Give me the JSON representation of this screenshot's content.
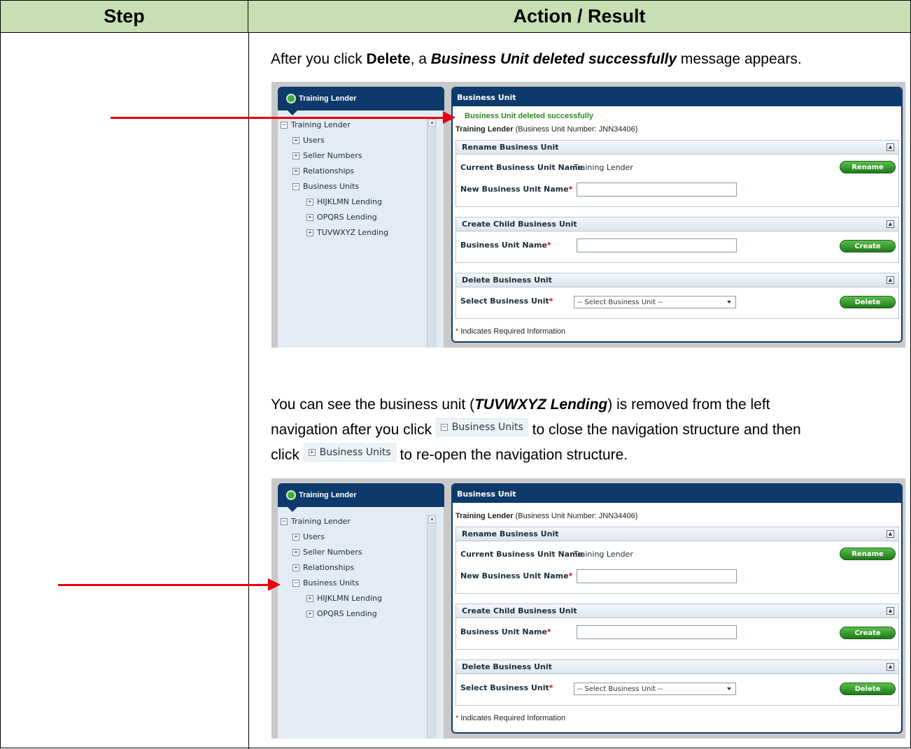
{
  "table": {
    "header_step": "Step",
    "header_action": "Action / Result"
  },
  "intro": {
    "before": "After you click ",
    "delete_word": "Delete",
    "mid": ", a ",
    "message_name": "Business Unit deleted successfully",
    "after": " message appears."
  },
  "explain": {
    "p1": "You can see the business unit (",
    "unit_name": "TUVWXYZ Lending",
    "p2": ") is removed from the left",
    "p3": "navigation after you click ",
    "p4": " to close the navigation structure and then",
    "p5": "click ",
    "p6": " to re-open the navigation structure.",
    "inline_label": "Business Units",
    "collapse_glyph": "−",
    "expand_glyph": "+"
  },
  "shot1": {
    "nav_tab": "Training Lender",
    "tree": [
      {
        "toggle": "−",
        "label": "Training Lender"
      },
      {
        "toggle": "+",
        "label": "Users"
      },
      {
        "toggle": "+",
        "label": "Seller Numbers"
      },
      {
        "toggle": "+",
        "label": "Relationships"
      },
      {
        "toggle": "−",
        "label": "Business Units"
      },
      {
        "toggle": "+",
        "label": "HIJKLMN Lending"
      },
      {
        "toggle": "+",
        "label": "OPQRS Lending"
      },
      {
        "toggle": "+",
        "label": "TUVWXYZ Lending"
      }
    ],
    "panel_title": "Business Unit",
    "success": "Business Unit deleted successfully",
    "bu_name": "Training Lender",
    "bu_number": " (Business Unit Number: JNN34406)",
    "rename_title": "Rename Business Unit",
    "current_label": "Current Business Unit Name",
    "current_value": "Training Lender",
    "rename_btn": "Rename",
    "new_label": "New Business Unit Name",
    "create_title": "Create Child Business Unit",
    "bu_name_label": "Business Unit Name",
    "create_btn": "Create",
    "delete_title": "Delete Business Unit",
    "select_label": "Select Business Unit",
    "select_value": "-- Select Business Unit --",
    "delete_btn": "Delete",
    "required_note": "Indicates Required Information",
    "asterisk": "*",
    "collapse_glyph": "▲",
    "scroll_up": "▲"
  },
  "shot2": {
    "nav_tab": "Training Lender",
    "tree": [
      {
        "toggle": "−",
        "label": "Training Lender"
      },
      {
        "toggle": "+",
        "label": "Users"
      },
      {
        "toggle": "+",
        "label": "Seller Numbers"
      },
      {
        "toggle": "+",
        "label": "Relationships"
      },
      {
        "toggle": "−",
        "label": "Business Units"
      },
      {
        "toggle": "+",
        "label": "HIJKLMN Lending"
      },
      {
        "toggle": "+",
        "label": "OPQRS Lending"
      }
    ],
    "panel_title": "Business Unit",
    "bu_name": "Training Lender",
    "bu_number": " (Business Unit Number: JNN34406)",
    "rename_title": "Rename Business Unit",
    "current_label": "Current Business Unit Name",
    "current_value": "Training Lender",
    "rename_btn": "Rename",
    "new_label": "New Business Unit Name",
    "create_title": "Create Child Business Unit",
    "bu_name_label": "Business Unit Name",
    "create_btn": "Create",
    "delete_title": "Delete Business Unit",
    "select_label": "Select Business Unit",
    "select_value": "-- Select Business Unit --",
    "delete_btn": "Delete",
    "required_note": "Indicates Required Information",
    "asterisk": "*",
    "collapse_glyph": "▲",
    "scroll_up": "▲"
  },
  "colors": {
    "header_fill": "#c6e0b4",
    "arrow": "#e8000b",
    "navy": "#0d3a6b",
    "success_green": "#2b8a1e",
    "button_green": "#2f9a24"
  }
}
